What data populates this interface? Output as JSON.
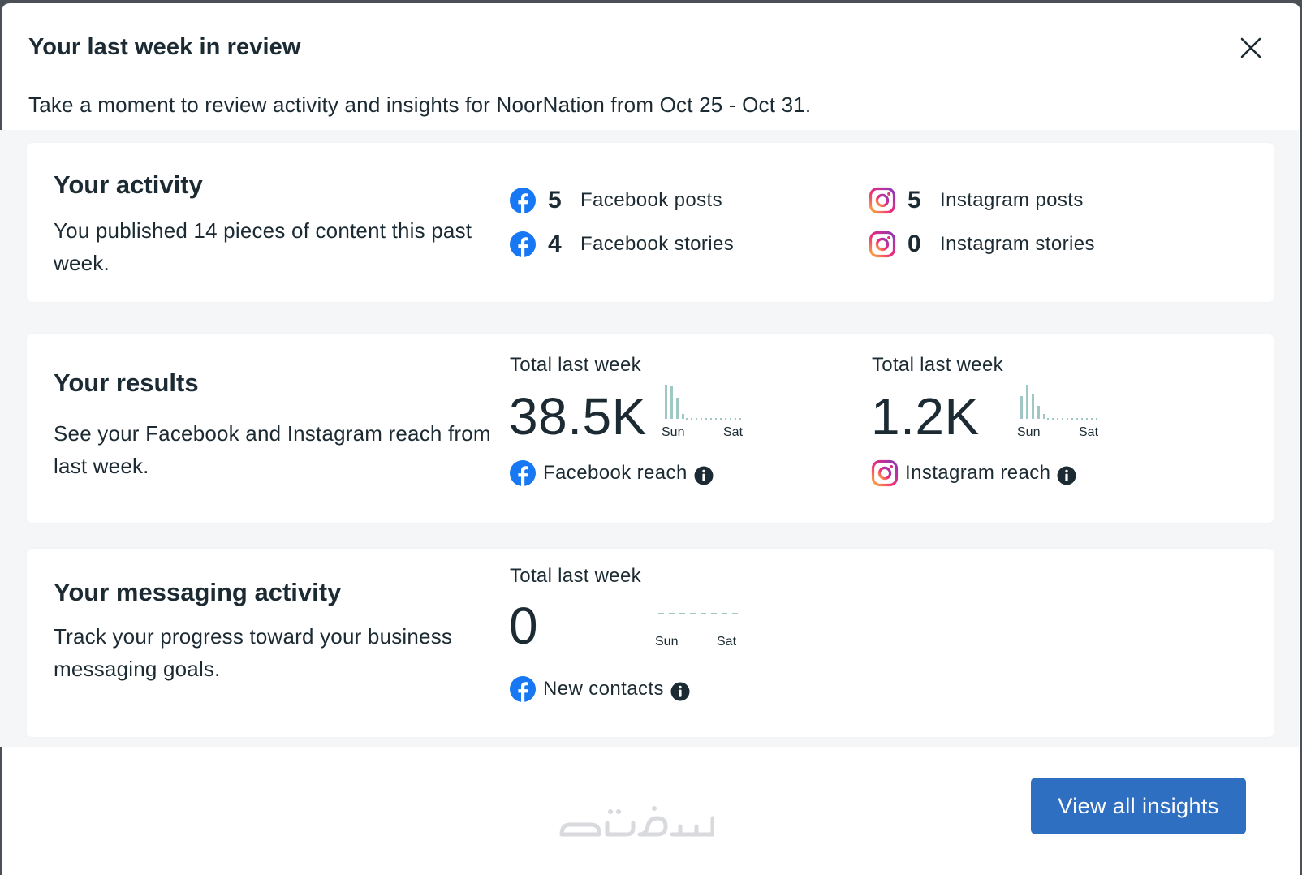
{
  "dialog": {
    "title": "Your last week in review",
    "subtitle": "Take a moment to review activity and insights for NoorNation from Oct 25 - Oct 31."
  },
  "activity": {
    "heading": "Your activity",
    "description": "You published 14 pieces of content this past week.",
    "stats": [
      {
        "icon": "facebook-icon",
        "count": "5",
        "label": "Facebook posts"
      },
      {
        "icon": "facebook-icon",
        "count": "4",
        "label": "Facebook stories"
      },
      {
        "icon": "instagram-icon",
        "count": "5",
        "label": "Instagram posts"
      },
      {
        "icon": "instagram-icon",
        "count": "0",
        "label": "Instagram stories"
      }
    ]
  },
  "results": {
    "heading": "Your results",
    "description": "See your Facebook and Instagram reach from last week.",
    "metrics": [
      {
        "top_label": "Total last week",
        "value": "38.5K",
        "start_day": "Sun",
        "end_day": "Sat",
        "source": "Facebook reach",
        "icon": "facebook-icon"
      },
      {
        "top_label": "Total last week",
        "value": "1.2K",
        "start_day": "Sun",
        "end_day": "Sat",
        "source": "Instagram reach",
        "icon": "instagram-icon"
      }
    ]
  },
  "messaging": {
    "heading": "Your messaging activity",
    "description": "Track your progress toward your business messaging goals.",
    "metric": {
      "top_label": "Total last week",
      "value": "0",
      "start_day": "Sun",
      "end_day": "Sat",
      "source": "New contacts",
      "icon": "facebook-icon"
    }
  },
  "footer": {
    "primary_button": "View all insights"
  },
  "colors": {
    "facebook": "#1877f2",
    "sparkline": "#9fc7c4",
    "button": "#2f6fc1",
    "text": "#1c2b33"
  }
}
